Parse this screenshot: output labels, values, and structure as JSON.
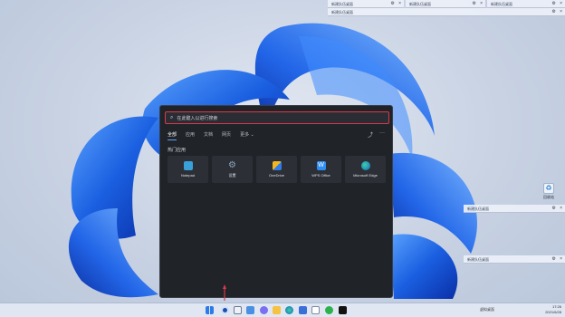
{
  "notifications": {
    "top": [
      {
        "label": "新建队伍桌面"
      },
      {
        "label": "新建队伍桌面"
      },
      {
        "label": "新建队伍桌面"
      },
      {
        "label": "新建队伍桌面"
      }
    ],
    "side": [
      {
        "label": "新建队伍桌面"
      },
      {
        "label": "新建队伍桌面"
      }
    ]
  },
  "recycle_bin": {
    "label": "回收站"
  },
  "start_panel": {
    "search_placeholder": "在此键入以进行搜索",
    "tabs": [
      {
        "label": "全部",
        "active": true
      },
      {
        "label": "应用"
      },
      {
        "label": "文档"
      },
      {
        "label": "网页"
      },
      {
        "label": "更多 ⌄"
      }
    ],
    "section_title": "热门应用",
    "apps": [
      {
        "label": "Notepad",
        "icon": "notepad-icon",
        "color": "#3aa0d8"
      },
      {
        "label": "设置",
        "icon": "gear-icon",
        "color": "#6b7f98"
      },
      {
        "label": "OneDrive",
        "icon": "onedrive-icon",
        "color": "#f2b720"
      },
      {
        "label": "WPS Office",
        "icon": "wps-icon",
        "color": "#2f8ef4"
      },
      {
        "label": "Microsoft Edge",
        "icon": "edge-icon",
        "color": "#1ba3a0"
      }
    ]
  },
  "taskbar": {
    "quick_tool": "虚拟桌面",
    "time": "17:26",
    "date": "2021/6/28"
  },
  "colors": {
    "accent": "#d93a4a",
    "panel_bg": "#202328",
    "taskbar_bg": "#e2e8f2"
  }
}
